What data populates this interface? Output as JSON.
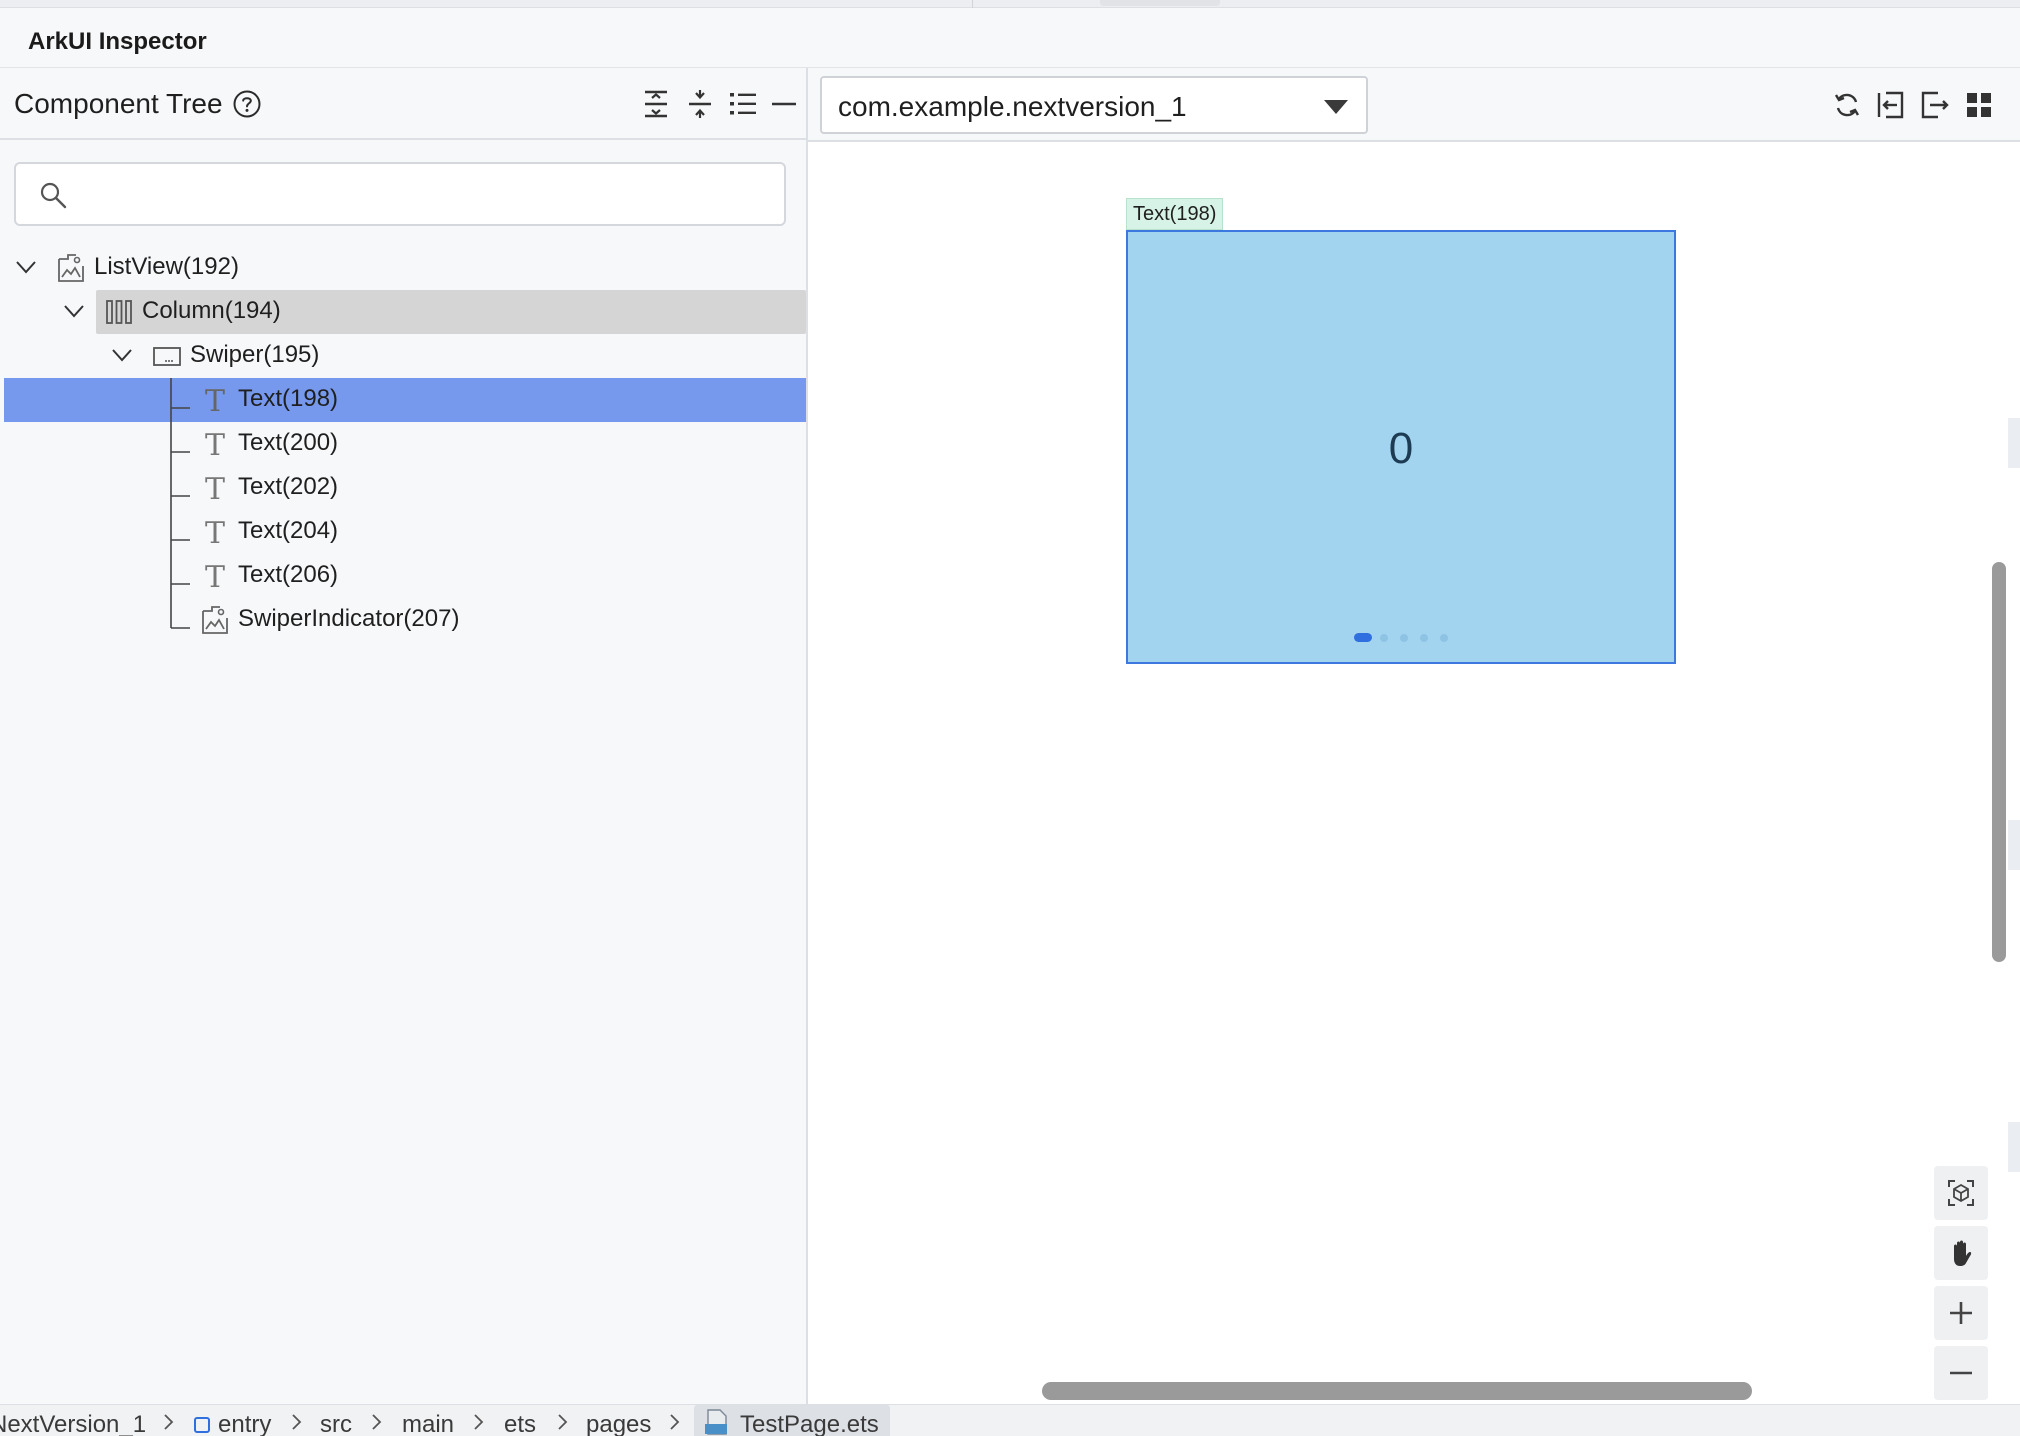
{
  "app": {
    "title": "ArkUI Inspector"
  },
  "tree_panel": {
    "title": "Component Tree",
    "search": {
      "value": "",
      "placeholder": ""
    },
    "toolbar_icons": [
      "expand-all-icon",
      "collapse-all-icon",
      "list-icon",
      "minimize-icon"
    ],
    "nodes": [
      {
        "label": "ListView(192)",
        "icon": "image-node-icon",
        "depth": 0,
        "expanded": true
      },
      {
        "label": "Column(194)",
        "icon": "column-icon",
        "depth": 1,
        "expanded": true,
        "state": "hover"
      },
      {
        "label": "Swiper(195)",
        "icon": "swiper-icon",
        "depth": 2,
        "expanded": true
      },
      {
        "label": "Text(198)",
        "icon": "text-icon",
        "depth": 3,
        "state": "selected"
      },
      {
        "label": "Text(200)",
        "icon": "text-icon",
        "depth": 3
      },
      {
        "label": "Text(202)",
        "icon": "text-icon",
        "depth": 3
      },
      {
        "label": "Text(204)",
        "icon": "text-icon",
        "depth": 3
      },
      {
        "label": "Text(206)",
        "icon": "text-icon",
        "depth": 3
      },
      {
        "label": "SwiperIndicator(207)",
        "icon": "image-node-icon",
        "depth": 3
      }
    ]
  },
  "preview_panel": {
    "package_select": "com.example.nextversion_1",
    "toolbar_icons": [
      "refresh-icon",
      "import-icon",
      "export-icon",
      "grid-view-icon"
    ],
    "selected_component_tag": "Text(198)",
    "swiper_text": "0",
    "indicator": {
      "count": 5,
      "active_index": 0
    },
    "side_tools": [
      "3d-view-icon",
      "hand-pan-icon",
      "zoom-in-icon",
      "zoom-out-icon",
      "locate-icon"
    ]
  },
  "colors": {
    "selected_row": "#7699ee",
    "hover_row": "#d5d5d5",
    "swiper_fill": "#a2d3ef",
    "swiper_border": "#3c78e0",
    "tag_fill": "#d7f2e6",
    "indicator_active": "#2f6fe0"
  },
  "breadcrumb": {
    "items": [
      "NextVersion_1",
      "entry",
      "src",
      "main",
      "ets",
      "pages",
      "TestPage.ets"
    ]
  }
}
